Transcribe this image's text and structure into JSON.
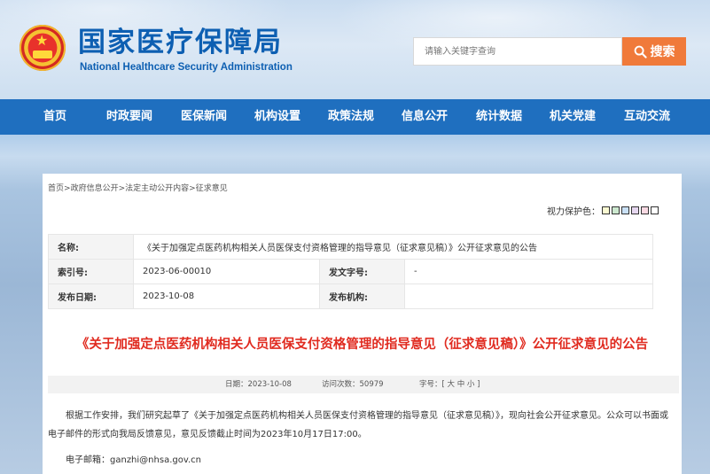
{
  "header": {
    "title_cn": "国家医疗保障局",
    "title_en": "National Healthcare Security Administration",
    "emblem_icon": "national-emblem"
  },
  "search": {
    "placeholder": "请输入关键字查询",
    "button_label": "搜索",
    "button_color": "#f07a3a"
  },
  "nav": {
    "color": "#1f6fbf",
    "items": [
      "首页",
      "时政要闻",
      "医保新闻",
      "机构设置",
      "政策法规",
      "信息公开",
      "统计数据",
      "机关党建",
      "互动交流"
    ]
  },
  "breadcrumb": [
    "首页",
    "政府信息公开",
    "法定主动公开内容",
    "征求意见"
  ],
  "protect": {
    "label": "视力保护色：",
    "colors": [
      "#fafad2",
      "#cce8cf",
      "#c9e0f5",
      "#e6d7f0",
      "#f9d9e3",
      "#ffffff"
    ]
  },
  "meta": {
    "name_label": "名称:",
    "name_value": "《关于加强定点医药机构相关人员医保支付资格管理的指导意见（征求意见稿）》公开征求意见的公告",
    "index_label": "索引号:",
    "index_value": "2023-06-00010",
    "docno_label": "发文字号:",
    "docno_value": "-",
    "date_label": "发布日期:",
    "date_value": "2023-10-08",
    "org_label": "发布机构:",
    "org_value": ""
  },
  "article": {
    "title": "《关于加强定点医药机构相关人员医保支付资格管理的指导意见（征求意见稿）》公开征求意见的公告",
    "title_color": "#e02b20",
    "date": "日期：2023-10-08",
    "visits": "访问次数：50979",
    "fontsize": "字号：[ 大 中 小 ]",
    "paragraph": "根据工作安排，我们研究起草了《关于加强定点医药机构相关人员医保支付资格管理的指导意见（征求意见稿）》，现向社会公开征求意见。公众可以书面或电子邮件的形式向我局反馈意见，意见反馈截止时间为2023年10月17日17:00。",
    "email": "电子邮箱：ganzhi@nhsa.gov.cn"
  }
}
